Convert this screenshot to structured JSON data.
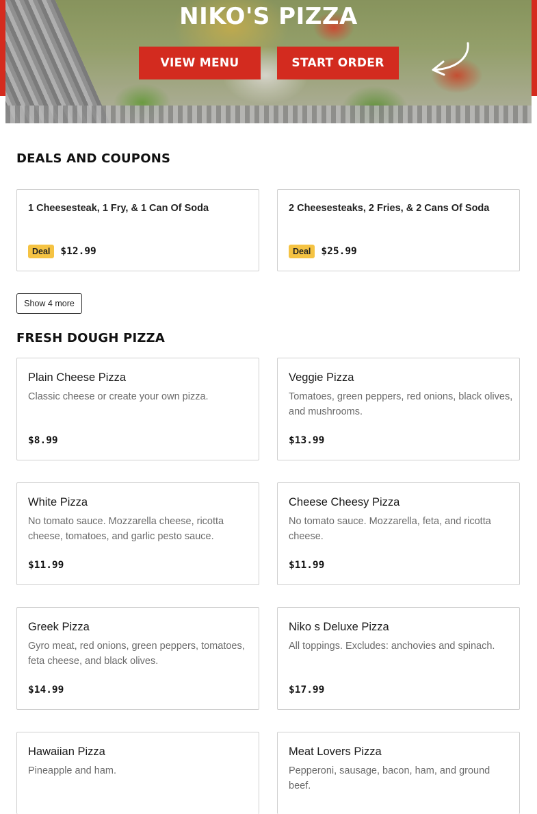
{
  "hero": {
    "title": "NIKO'S PIZZA",
    "view_menu_label": "VIEW MENU",
    "start_order_label": "START ORDER",
    "accent_color": "#d52b1e",
    "arrow_icon": "curved-arrow-icon"
  },
  "deals": {
    "title": "DEALS AND COUPONS",
    "items": [
      {
        "name": "1 Cheesesteak, 1 Fry, & 1 Can Of Soda",
        "badge": "Deal",
        "price": "$12.99"
      },
      {
        "name": "2 Cheesesteaks, 2 Fries, & 2 Cans Of Soda",
        "badge": "Deal",
        "price": "$25.99"
      }
    ],
    "show_more_label": "Show 4 more",
    "badge_color": "#f5c343"
  },
  "pizza": {
    "title": "FRESH DOUGH PIZZA",
    "items": [
      {
        "name": "Plain Cheese Pizza",
        "description": "Classic cheese or create your own pizza.",
        "price": "$8.99"
      },
      {
        "name": "Veggie Pizza",
        "description": "Tomatoes, green peppers, red onions, black olives, and mushrooms.",
        "price": "$13.99"
      },
      {
        "name": "White Pizza",
        "description": "No tomato sauce. Mozzarella cheese, ricotta cheese, tomatoes, and garlic pesto sauce.",
        "price": "$11.99"
      },
      {
        "name": "Cheese Cheesy Pizza",
        "description": "No tomato sauce. Mozzarella, feta, and ricotta cheese.",
        "price": "$11.99"
      },
      {
        "name": "Greek Pizza",
        "description": "Gyro meat, red onions, green peppers, tomatoes, feta cheese, and black olives.",
        "price": "$14.99"
      },
      {
        "name": "Niko s Deluxe Pizza",
        "description": "All toppings. Excludes: anchovies and spinach.",
        "price": "$17.99"
      },
      {
        "name": "Hawaiian Pizza",
        "description": "Pineapple and ham.",
        "price": ""
      },
      {
        "name": "Meat Lovers Pizza",
        "description": "Pepperoni, sausage, bacon, ham, and ground beef.",
        "price": ""
      }
    ]
  }
}
